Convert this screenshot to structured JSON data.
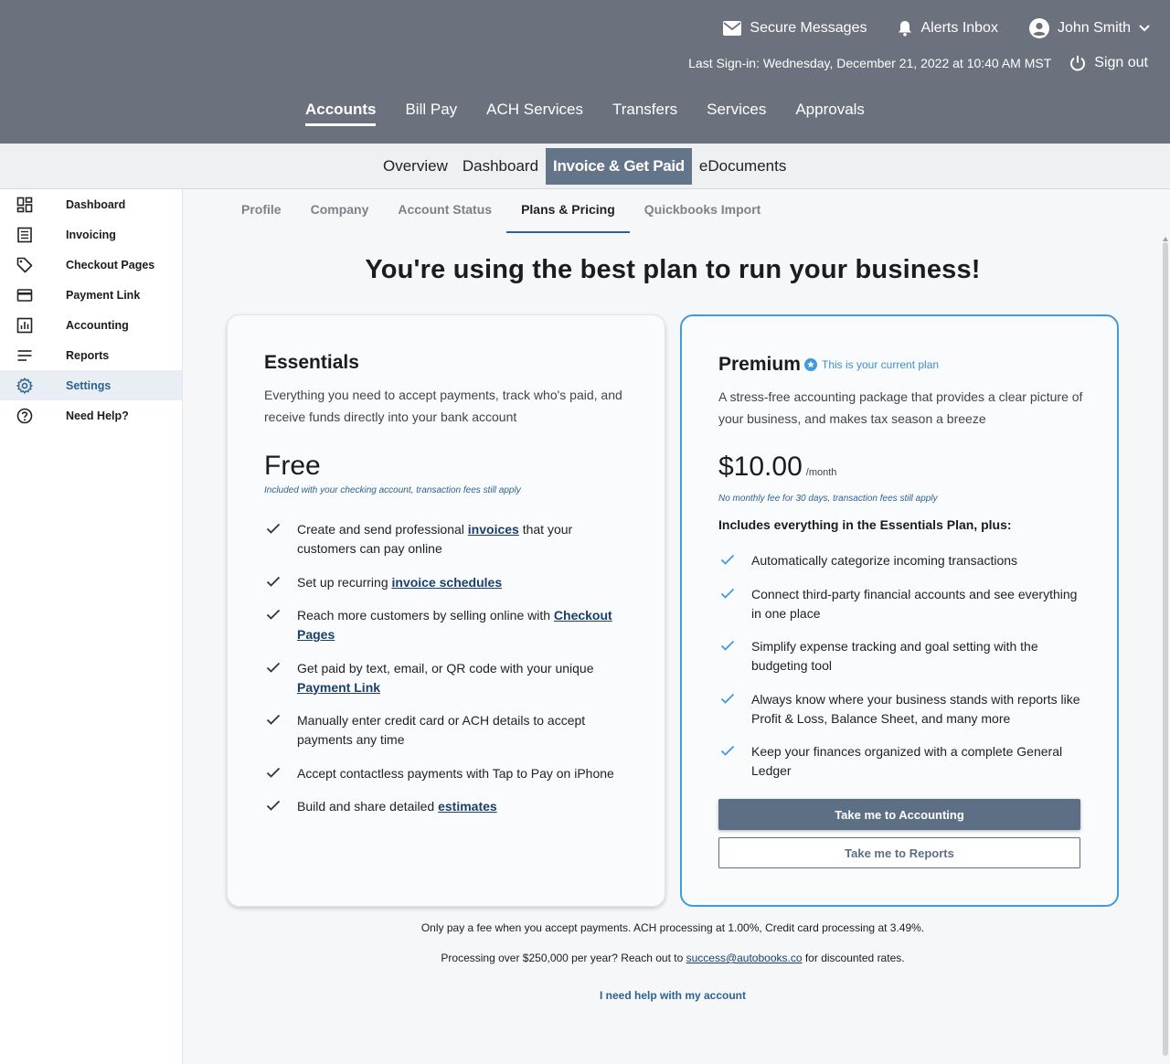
{
  "utility": {
    "secure_messages": "Secure Messages",
    "alerts_inbox": "Alerts Inbox",
    "user_name": "John Smith",
    "last_signin": "Last Sign-in: Wednesday, December 21, 2022 at 10:40 AM MST",
    "sign_out": "Sign out"
  },
  "main_nav": [
    {
      "label": "Accounts",
      "active": true
    },
    {
      "label": "Bill Pay"
    },
    {
      "label": "ACH Services"
    },
    {
      "label": "Transfers"
    },
    {
      "label": "Services"
    },
    {
      "label": "Approvals"
    }
  ],
  "sub_nav": [
    {
      "label": "Overview"
    },
    {
      "label": "Dashboard"
    },
    {
      "label": "Invoice & Get Paid",
      "active": true
    },
    {
      "label": "eDocuments"
    }
  ],
  "sidebar": [
    {
      "label": "Dashboard",
      "icon": "dashboard-icon"
    },
    {
      "label": "Invoicing",
      "icon": "invoice-icon"
    },
    {
      "label": "Checkout Pages",
      "icon": "tag-icon"
    },
    {
      "label": "Payment Link",
      "icon": "card-icon"
    },
    {
      "label": "Accounting",
      "icon": "chart-icon"
    },
    {
      "label": "Reports",
      "icon": "lines-icon"
    },
    {
      "label": "Settings",
      "icon": "gear-icon",
      "active": true
    },
    {
      "label": "Need Help?",
      "icon": "help-icon"
    }
  ],
  "tabs": [
    {
      "label": "Profile"
    },
    {
      "label": "Company"
    },
    {
      "label": "Account Status"
    },
    {
      "label": "Plans & Pricing",
      "active": true
    },
    {
      "label": "Quickbooks Import"
    }
  ],
  "headline": "You're using the best plan to run your business!",
  "essentials": {
    "name": "Essentials",
    "description": "Everything you need to accept payments, track who's paid, and receive funds directly into your bank account",
    "price": "Free",
    "price_note": "Included with your checking account, transaction fees still apply",
    "features": [
      {
        "pre": "Create and send professional ",
        "link": "invoices",
        "post": " that your customers can pay online"
      },
      {
        "pre": "Set up recurring ",
        "link": "invoice schedules",
        "post": ""
      },
      {
        "pre": "Reach more customers by selling online with ",
        "link": "Checkout Pages",
        "post": ""
      },
      {
        "pre": "Get paid by text, email, or QR code with your unique ",
        "link": "Payment Link",
        "post": ""
      },
      {
        "pre": "Manually enter credit card or ACH details to accept payments any time",
        "link": "",
        "post": ""
      },
      {
        "pre": "Accept contactless payments with Tap to Pay on iPhone",
        "link": "",
        "post": ""
      },
      {
        "pre": "Build and share detailed ",
        "link": "estimates",
        "post": ""
      }
    ]
  },
  "premium": {
    "name": "Premium",
    "badge": "This is your current plan",
    "description": "A stress-free accounting package that provides a clear picture of your business, and makes tax season a breeze",
    "price": "$10.00",
    "per": "/month",
    "price_note": "No monthly fee for 30 days, transaction fees still apply",
    "includes": "Includes everything in the Essentials Plan, plus:",
    "features": [
      {
        "pre": "Automatically categorize incoming transactions",
        "link": "",
        "post": ""
      },
      {
        "pre": "Connect third-party financial accounts and see everything in one place",
        "link": "",
        "post": ""
      },
      {
        "pre": "Simplify expense tracking and goal setting with the budgeting tool",
        "link": "",
        "post": ""
      },
      {
        "pre": "Always know where your business stands with reports like Profit & Loss, Balance Sheet, and many more",
        "link": "",
        "post": ""
      },
      {
        "pre": "Keep your finances organized with a complete General Ledger",
        "link": "",
        "post": ""
      }
    ],
    "primary_button": "Take me to Accounting",
    "secondary_button": "Take me to Reports"
  },
  "footer": {
    "fees": "Only pay a fee when you accept payments. ACH processing at 1.00%, Credit card processing at 3.49%.",
    "volume_pre": "Processing over $250,000 per year? Reach out to ",
    "volume_link": "success@autobooks.co",
    "volume_post": " for discounted rates.",
    "help": "I need help with my account"
  },
  "colors": {
    "topbar": "#6b717d",
    "accent": "#2d6291",
    "premium_border": "#3e9be0",
    "button": "#5d6f84"
  }
}
